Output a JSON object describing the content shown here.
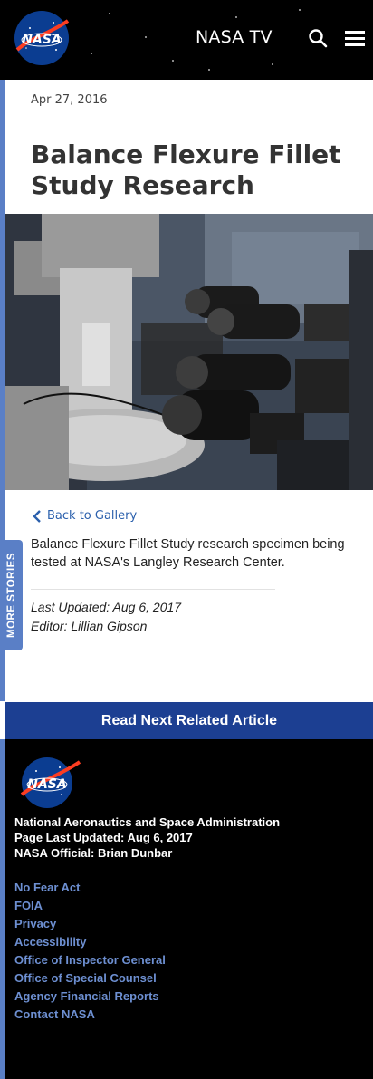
{
  "header": {
    "logo_text": "NASA",
    "nasa_tv": "NASA TV",
    "search_icon": "search-icon",
    "menu_icon": "hamburger-menu-icon"
  },
  "article": {
    "date": "Apr 27, 2016",
    "title": "Balance Flexure Fillet Study Research",
    "image_alt": "Balance flexure fillet specimen in test rig with cameras",
    "back_label": "Back to Gallery",
    "caption": "Balance Flexure Fillet Study research specimen being tested at NASA's Langley Research Center.",
    "last_updated": "Last Updated: Aug 6, 2017",
    "editor": "Editor: Lillian Gipson"
  },
  "more_stories": "MORE STORIES",
  "read_next": "Read Next Related Article",
  "footer": {
    "logo_text": "NASA",
    "agency": "National Aeronautics and Space Administration",
    "page_updated": "Page Last Updated: Aug 6, 2017",
    "official": "NASA Official: Brian Dunbar",
    "links": [
      "No Fear Act",
      "FOIA",
      "Privacy",
      "Accessibility",
      "Office of Inspector General",
      "Office of Special Counsel",
      "Agency Financial Reports",
      "Contact NASA"
    ]
  },
  "colors": {
    "accent_blue": "#5a7fc6",
    "button_blue": "#1c3f92",
    "link_blue": "#2a5fac",
    "footer_link": "#6d8fd1"
  }
}
